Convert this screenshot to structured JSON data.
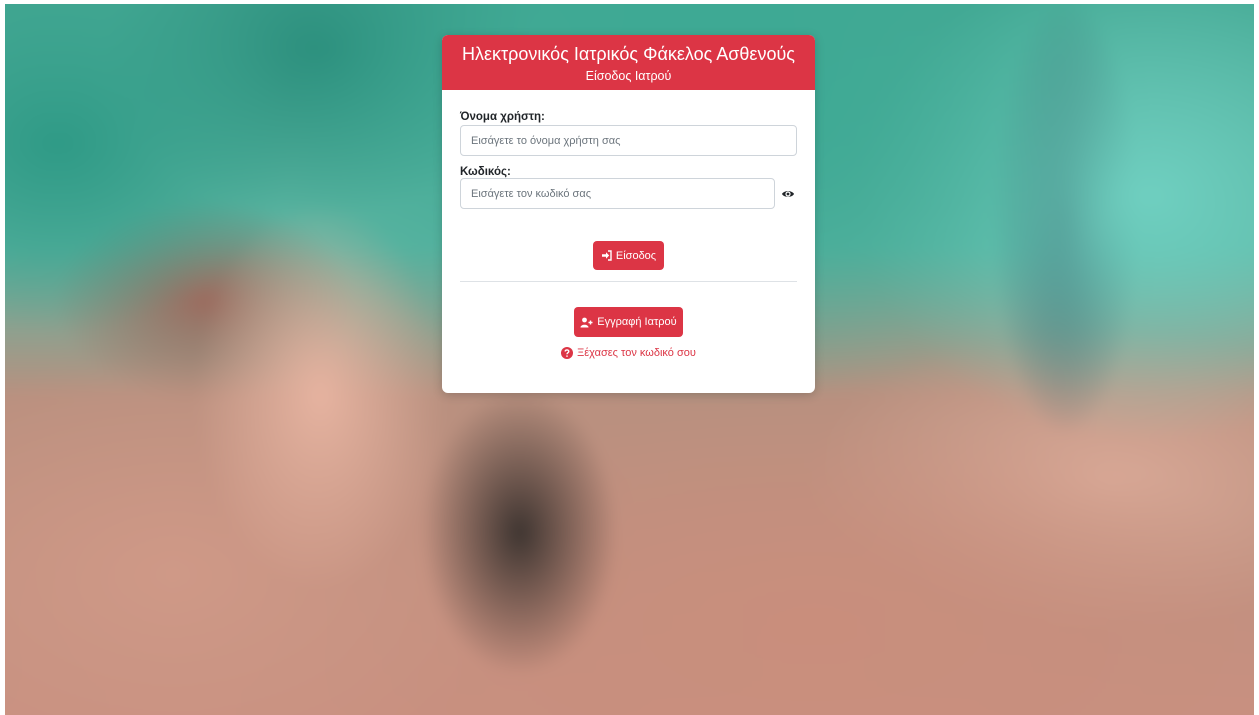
{
  "header": {
    "title": "Ηλεκτρονικός Ιατρικός Φάκελος Ασθενούς",
    "subtitle": "Είσοδος Ιατρού"
  },
  "form": {
    "username_label": "Όνομα χρήστη:",
    "username_placeholder": "Εισάγετε το όνομα χρήστη σας",
    "username_value": "",
    "password_label": "Κωδικός:",
    "password_placeholder": "Εισάγετε τον κωδικό σας",
    "password_value": ""
  },
  "actions": {
    "login_label": "Είσοδος",
    "register_label": "Εγγραφή Ιατρού",
    "forgot_label": "Ξέχασες τον κωδικό σου"
  },
  "icons": {
    "login": "sign-in-icon",
    "register": "user-plus-icon",
    "forgot": "question-circle-icon",
    "toggle_password": "eye-icon"
  },
  "colors": {
    "accent": "#dc3545",
    "card_bg": "#ffffff"
  }
}
